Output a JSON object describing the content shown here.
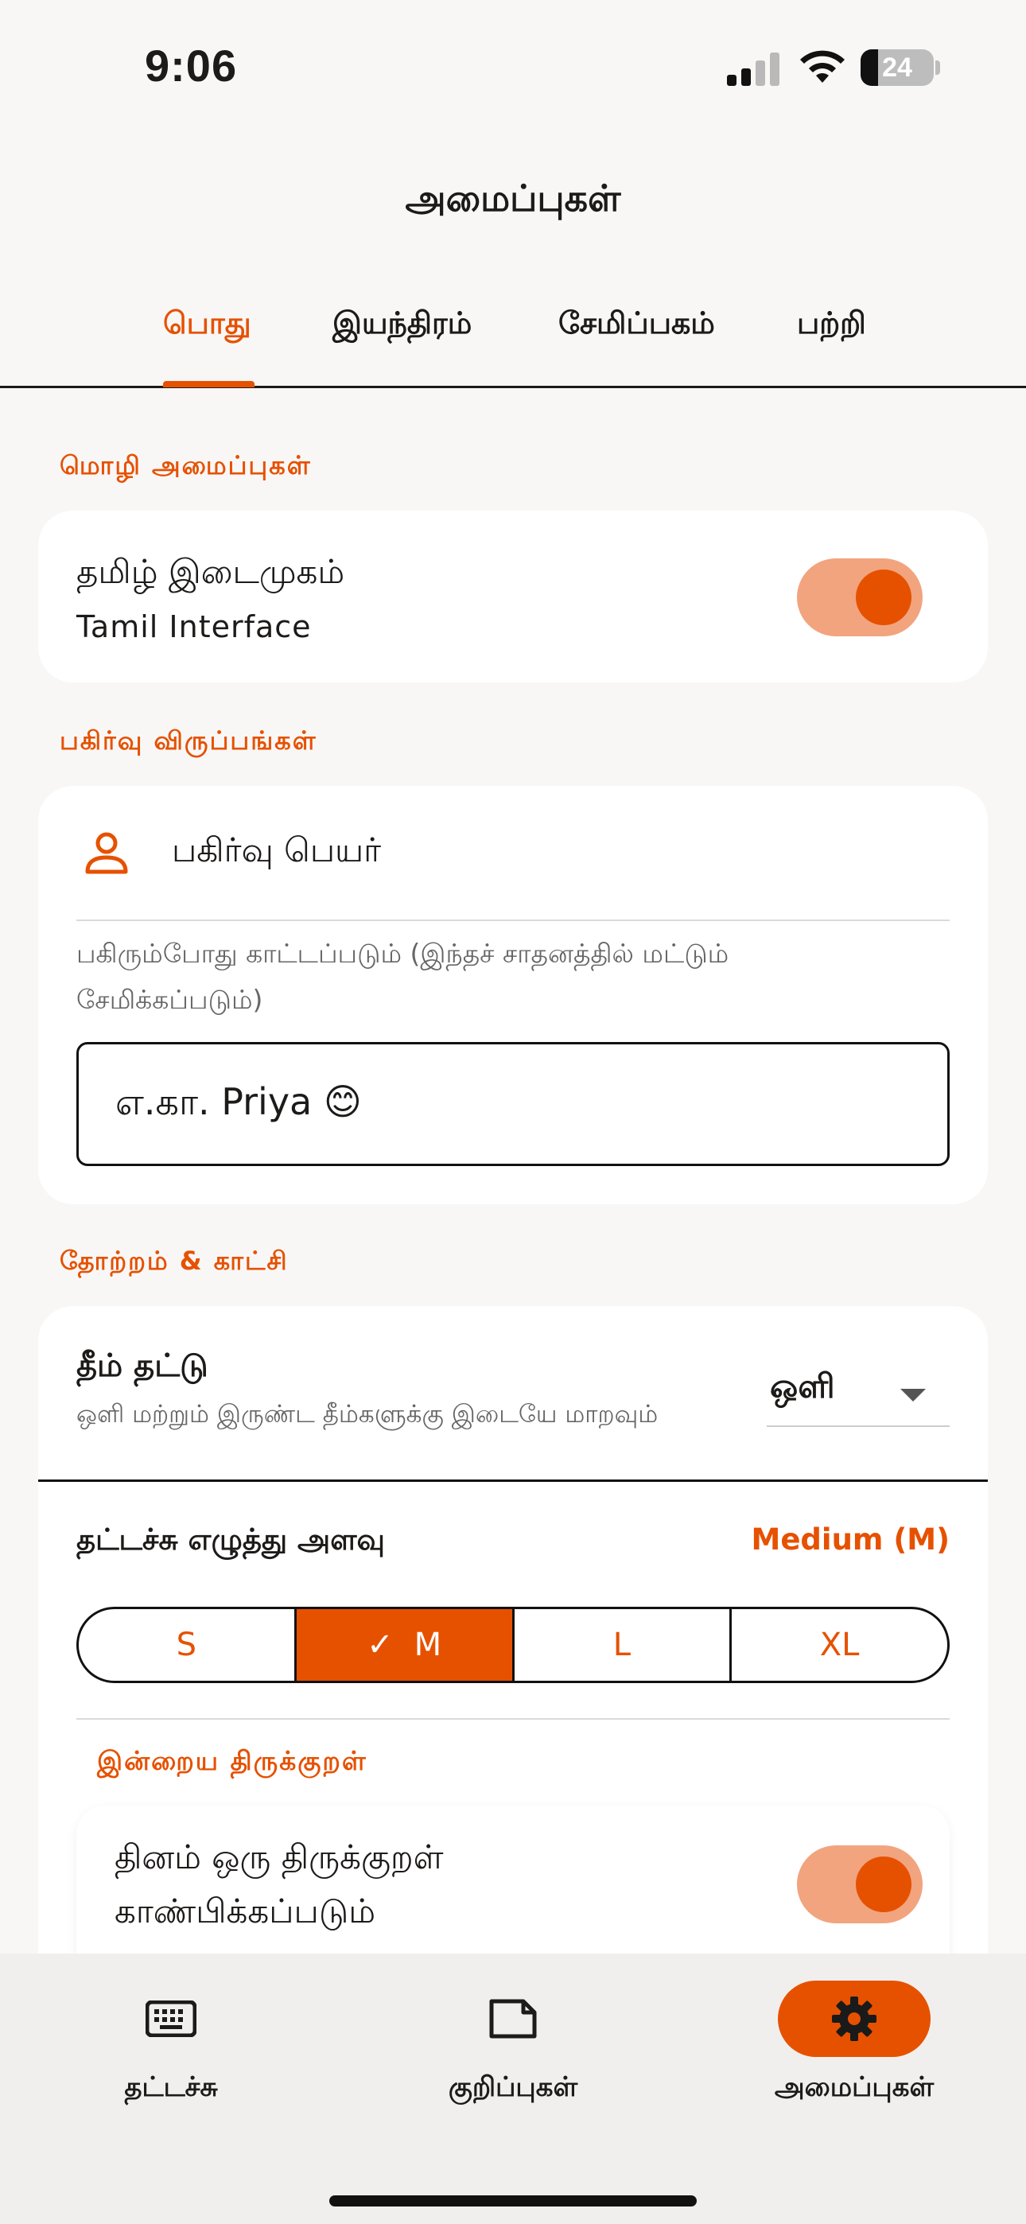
{
  "status_bar": {
    "time": "9:06",
    "battery": "24",
    "battery_level": 0.24
  },
  "header": {
    "title": "அமைப்புகள்"
  },
  "tabs": [
    {
      "label": "பொது",
      "active": true
    },
    {
      "label": "இயந்திரம்",
      "active": false
    },
    {
      "label": "சேமிப்பகம்",
      "active": false
    },
    {
      "label": "பற்றி",
      "active": false
    }
  ],
  "language_section": {
    "label": "மொழி அமைப்புகள்",
    "title": "தமிழ் இடைமுகம்",
    "subtitle": "Tamil Interface",
    "enabled": true
  },
  "sharing_section": {
    "label": "பகிர்வு விருப்பங்கள்",
    "field_title": "பகிர்வு பெயர்",
    "helper": "பகிரும்போது காட்டப்படும் (இந்தச் சாதனத்தில் மட்டும் சேமிக்கப்படும்)",
    "value": "எ.கா. Priya 😊"
  },
  "appearance_section": {
    "label": "தோற்றம் & காட்சி",
    "theme_title": "தீம் தட்டு",
    "theme_subtitle": "ஒளி மற்றும் இருண்ட தீம்களுக்கு இடையே மாறவும்",
    "theme_value": "ஒளி",
    "font_size_title": "தட்டச்சு எழுத்து அளவு",
    "font_size_value": "Medium (M)",
    "sizes": [
      {
        "label": "S",
        "selected": false
      },
      {
        "label": "M",
        "selected": true
      },
      {
        "label": "L",
        "selected": false
      },
      {
        "label": "XL",
        "selected": false
      }
    ],
    "kural_label": "இன்றைய திருக்குறள்",
    "kural_line1": "தினம் ஒரு திருக்குறள்",
    "kural_line2": "காண்பிக்கப்படும்",
    "kural_enabled": true
  },
  "bottom_nav": [
    {
      "label": "தட்டச்சு",
      "icon": "keyboard-icon",
      "active": false
    },
    {
      "label": "குறிப்புகள்",
      "icon": "note-icon",
      "active": false
    },
    {
      "label": "அமைப்புகள்",
      "icon": "gear-icon",
      "active": true
    }
  ],
  "colors": {
    "accent": "#e65100",
    "accent_light": "#f2a47e",
    "background": "#f8f7f6",
    "card": "#ffffff"
  }
}
